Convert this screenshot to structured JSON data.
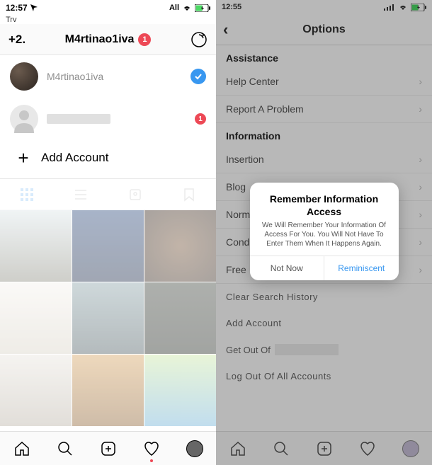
{
  "left": {
    "status": {
      "time": "12:57",
      "carrier": "Trv",
      "network": "All"
    },
    "header": {
      "switcher_badge": "+2.",
      "username": "M4rtinao1iva",
      "notif_count": "1"
    },
    "accounts": [
      {
        "name": "M4rtinao1iva",
        "selected": true
      },
      {
        "name": "",
        "badge": "1"
      }
    ],
    "add_account": "Add Account"
  },
  "right": {
    "status": {
      "time": "12:55"
    },
    "header": {
      "title": "Options"
    },
    "sections": {
      "assistance_h": "Assistance",
      "help_center": "Help Center",
      "report_problem": "Report A Problem",
      "information_h": "Information",
      "insertion": "Insertion",
      "blog": "Blog",
      "norm": "Norm",
      "cond": "Cond",
      "free": "Free",
      "clear_history": "Clear Search History",
      "add_account": "Add Account",
      "get_out": "Get Out Of",
      "log_out_all": "Log Out Of All Accounts"
    },
    "modal": {
      "title": "Remember Information Access",
      "text": "We Will Remember Your Information Of Access For You. You Will Not Have To Enter Them When It Happens Again.",
      "btn_left": "Not Now",
      "btn_right": "Reminiscent"
    }
  }
}
